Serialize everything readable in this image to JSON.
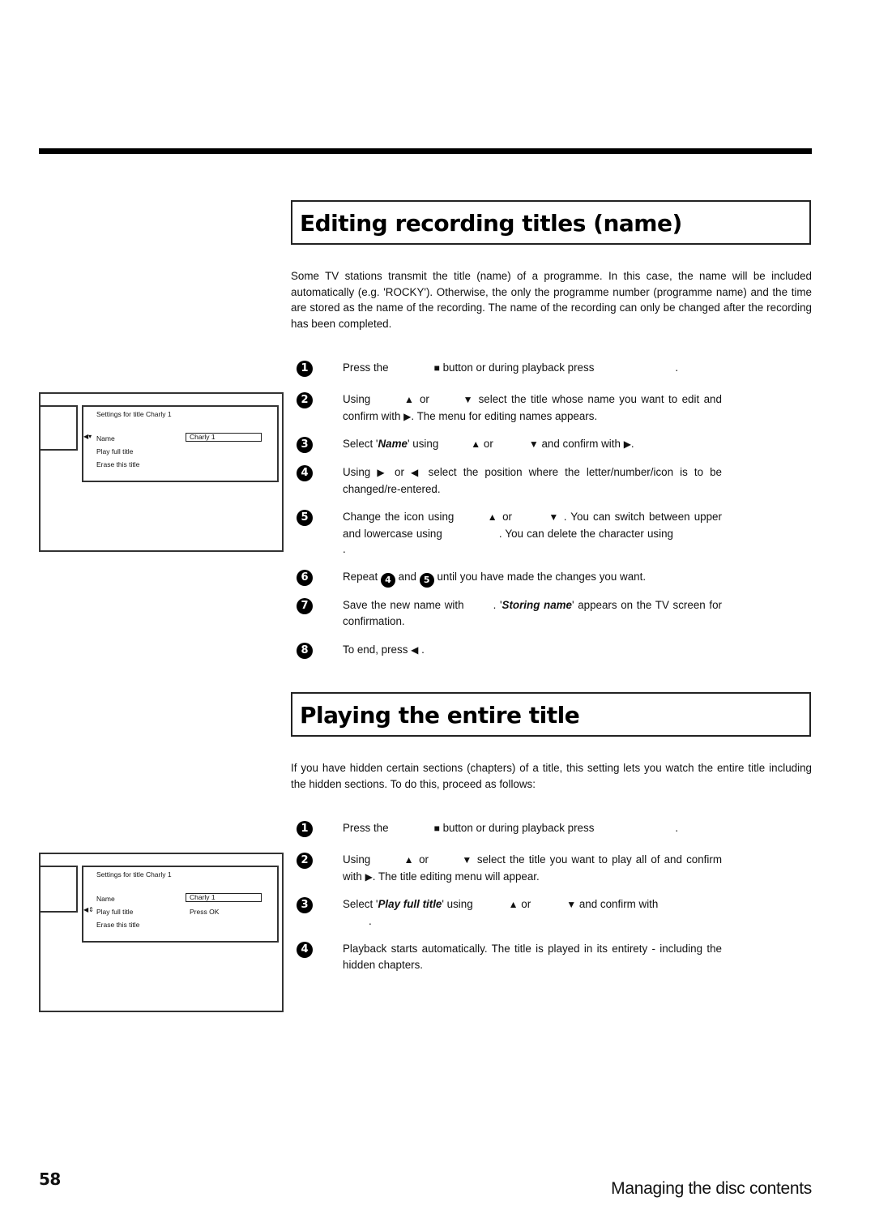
{
  "sections": [
    {
      "title": "Editing recording titles (name)",
      "intro": "Some TV stations transmit the title (name) of a programme. In this case, the name will be included automatically (e.g. 'ROCKY'). Otherwise, the only the programme number (programme name) and the time are stored as the name of the recording. The name of the recording can only be changed after the recording has been completed.",
      "steps": [
        {
          "number": "1",
          "parts": [
            "Press the",
            "■",
            "button or during playback press",
            "."
          ]
        },
        {
          "number": "2",
          "parts": [
            "Using",
            "▲",
            "or",
            "▼",
            "select the title whose name you want to edit and confirm with",
            "▶",
            ". The menu for editing names appears."
          ]
        },
        {
          "number": "3",
          "parts": [
            "Select '",
            "Name",
            "' using",
            "▲",
            "or",
            "▼",
            "and confirm with",
            "▶",
            "."
          ]
        },
        {
          "number": "4",
          "parts": [
            "Using",
            "▶",
            "or",
            "◀",
            "select the position where the letter/number/icon is to be changed/re-entered."
          ]
        },
        {
          "number": "5",
          "parts": [
            "Change the icon using",
            "▲",
            "or",
            "▼",
            ". You can switch between upper and lowercase using",
            ". You can delete the character using",
            "."
          ]
        },
        {
          "number": "6",
          "parts": [
            "Repeat",
            "4",
            "and",
            "5",
            "until you have made the changes you want."
          ]
        },
        {
          "number": "7",
          "parts": [
            "Save the new name with",
            ". '",
            "Storing name",
            "' appears on the TV screen for confirmation."
          ]
        },
        {
          "number": "8",
          "parts": [
            "To end, press",
            "◀",
            "."
          ]
        }
      ],
      "screen": {
        "panel_title": "Settings for title Charly 1",
        "items": [
          "Name",
          "Play full title",
          "Erase this title"
        ],
        "name_value": "Charly 1",
        "cursor_symbol": "◀▾",
        "selected_item": "Name"
      }
    },
    {
      "title": "Playing the entire title",
      "intro": "If you have hidden certain sections (chapters) of a title, this setting lets you watch the entire title including the hidden sections. To do this, proceed as follows:",
      "steps": [
        {
          "number": "1",
          "parts": [
            "Press the",
            "■",
            "button or during playback press",
            "."
          ]
        },
        {
          "number": "2",
          "parts": [
            "Using",
            "▲",
            "or",
            "▼",
            "select the title you want to play all of and confirm with",
            "▶",
            ". The title editing menu will appear."
          ]
        },
        {
          "number": "3",
          "parts": [
            "Select '",
            "Play full title",
            "' using",
            "▲",
            "or",
            "▼",
            "and confirm with",
            "."
          ]
        },
        {
          "number": "4",
          "parts": [
            "Playback starts automatically. The title is played in its entirety - including the hidden chapters."
          ]
        }
      ],
      "screen": {
        "panel_title": "Settings for title Charly 1",
        "items": [
          "Name",
          "Play full title",
          "Erase this title"
        ],
        "name_value": "Charly 1",
        "play_value": "Press OK",
        "cursor_symbol": "◀⇕",
        "selected_item": "Play full title"
      }
    }
  ],
  "footer": {
    "page_number": "58",
    "chapter": "Managing the disc contents"
  }
}
